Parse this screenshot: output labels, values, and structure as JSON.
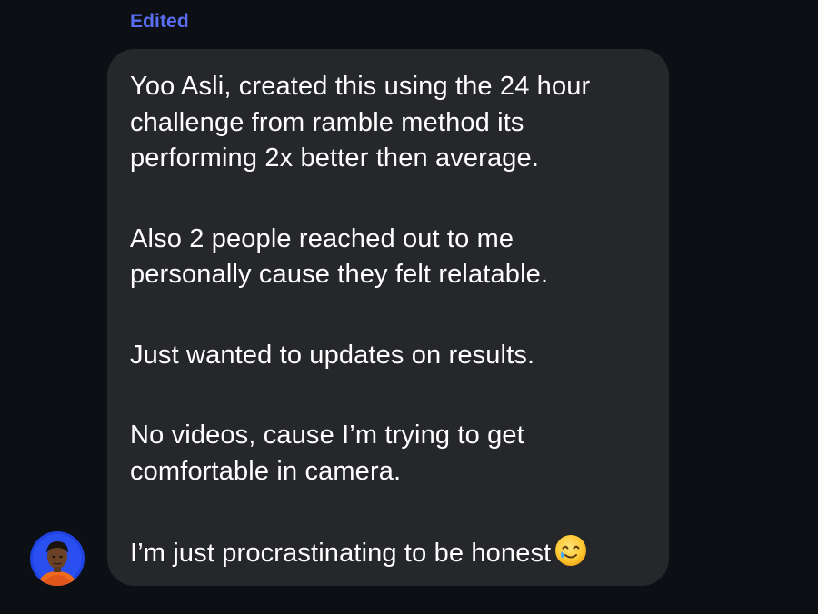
{
  "message": {
    "status_label": "Edited",
    "paragraphs": [
      {
        "lines": [
          "Yoo Asli, created this using the 24 hour",
          "challenge from ramble method its",
          "performing 2x better then average."
        ]
      },
      {
        "lines": [
          "Also 2 people reached out to me",
          "personally cause they felt relatable."
        ]
      },
      {
        "lines": [
          "Just wanted to updates on results."
        ]
      },
      {
        "lines": [
          "No videos, cause I’m trying to get",
          "comfortable in camera."
        ]
      },
      {
        "lines": [
          "I’m just procrastinating to be honest"
        ]
      }
    ],
    "emoji": "smiling-face-with-tear-icon"
  },
  "sender": {
    "avatar": "user-avatar"
  },
  "colors": {
    "background": "#0c0f13",
    "bubble": "#25272b",
    "edited_label": "#5a6ef2",
    "text": "#ffffff"
  }
}
